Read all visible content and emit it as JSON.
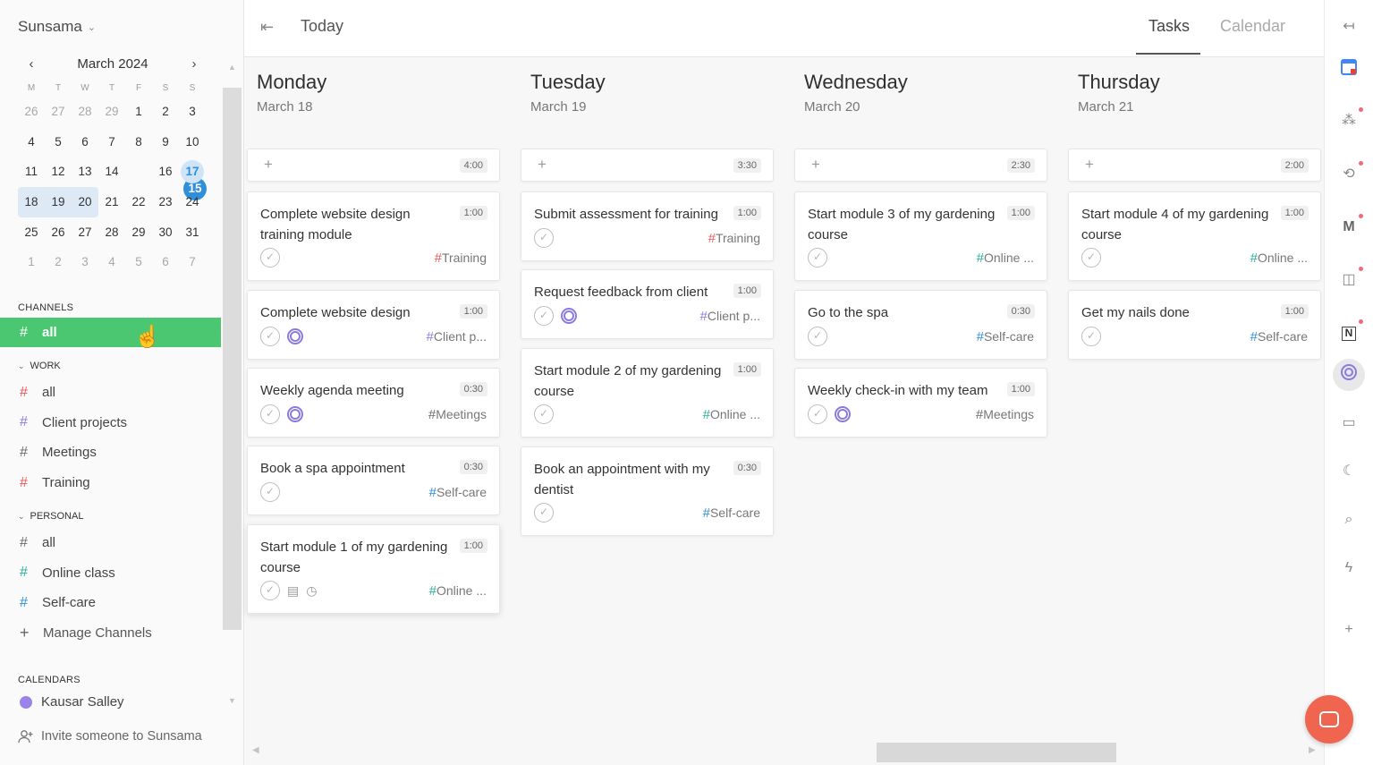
{
  "sidebar": {
    "workspace": "Sunsama",
    "calendar": {
      "month_label": "March 2024",
      "weekdays": [
        "M",
        "T",
        "W",
        "T",
        "F",
        "S",
        "S"
      ],
      "rows": [
        [
          "26",
          "27",
          "28",
          "29",
          "1",
          "2",
          "3"
        ],
        [
          "4",
          "5",
          "6",
          "7",
          "8",
          "9",
          "10"
        ],
        [
          "11",
          "12",
          "13",
          "14",
          "15",
          "16",
          "17"
        ],
        [
          "18",
          "19",
          "20",
          "21",
          "22",
          "23",
          "24"
        ],
        [
          "25",
          "26",
          "27",
          "28",
          "29",
          "30",
          "31"
        ],
        [
          "1",
          "2",
          "3",
          "4",
          "5",
          "6",
          "7"
        ]
      ]
    },
    "channels_label": "CHANNELS",
    "all_channel": "all",
    "work_label": "WORK",
    "work_channels": [
      "all",
      "Client projects",
      "Meetings",
      "Training"
    ],
    "personal_label": "PERSONAL",
    "personal_channels": [
      "all",
      "Online class",
      "Self-care"
    ],
    "manage_channels": "Manage Channels",
    "calendars_label": "CALENDARS",
    "calendar_user": "Kausar Salley",
    "invite": "Invite someone to Sunsama"
  },
  "topbar": {
    "today": "Today",
    "tab_tasks": "Tasks",
    "tab_calendar": "Calendar"
  },
  "colors": {
    "accent_green": "#4cc771",
    "today_blue": "#2f8fd8",
    "tag_training": "#e85a5a",
    "tag_client": "#8a7be0",
    "tag_meetings": "#6b6b6b",
    "tag_online": "#2ab09a",
    "tag_selfcare": "#2f8fd8"
  },
  "days": [
    {
      "name": "Monday",
      "date": "March 18",
      "total": "4:00",
      "tasks": [
        {
          "title": "Complete website design training module",
          "time": "1:00",
          "tag": "Training"
        },
        {
          "title": "Complete website design",
          "time": "1:00",
          "tag": "Client p..."
        },
        {
          "title": "Weekly agenda meeting",
          "time": "0:30",
          "tag": "Meetings"
        },
        {
          "title": "Book a spa appointment",
          "time": "0:30",
          "tag": "Self-care"
        },
        {
          "title": "Start module 1 of my gardening course",
          "time": "1:00",
          "tag": "Online ..."
        }
      ]
    },
    {
      "name": "Tuesday",
      "date": "March 19",
      "total": "3:30",
      "tasks": [
        {
          "title": "Submit assessment for training",
          "time": "1:00",
          "tag": "Training"
        },
        {
          "title": "Request feedback from client",
          "time": "1:00",
          "tag": "Client p..."
        },
        {
          "title": "Start module 2 of my gardening course",
          "time": "1:00",
          "tag": "Online ..."
        },
        {
          "title": "Book an appointment with my dentist",
          "time": "0:30",
          "tag": "Self-care"
        }
      ]
    },
    {
      "name": "Wednesday",
      "date": "March 20",
      "total": "2:30",
      "tasks": [
        {
          "title": "Start module 3 of my gardening course",
          "time": "1:00",
          "tag": "Online ..."
        },
        {
          "title": "Go to the spa",
          "time": "0:30",
          "tag": "Self-care"
        },
        {
          "title": "Weekly check-in with my team",
          "time": "1:00",
          "tag": "Meetings"
        }
      ]
    },
    {
      "name": "Thursday",
      "date": "March 21",
      "total": "2:00",
      "tasks": [
        {
          "title": "Start module 4 of my gardening course",
          "time": "1:00",
          "tag": "Online ..."
        },
        {
          "title": "Get my nails done",
          "time": "1:00",
          "tag": "Self-care"
        }
      ]
    }
  ],
  "rail_icons": [
    "collapse-right-icon",
    "google-calendar-icon",
    "asana-icon",
    "sync-icon",
    "gmail-icon",
    "trello-icon",
    "notion-icon",
    "focus-icon",
    "archive-icon",
    "moon-icon",
    "search-icon",
    "lightning-icon",
    "add-icon"
  ]
}
